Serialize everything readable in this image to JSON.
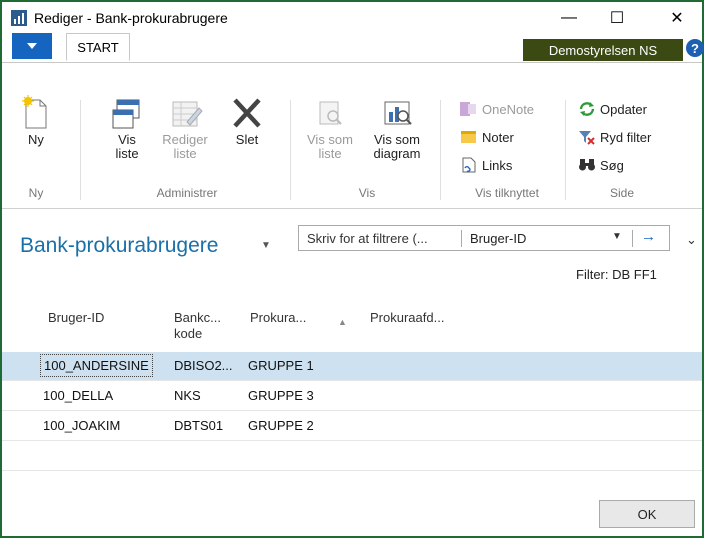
{
  "window": {
    "title": "Rediger - Bank-prokurabrugere",
    "minimize": "—",
    "maximize": "☐",
    "close": "✕"
  },
  "ribbon": {
    "tab_start": "START",
    "company": "Demostyrelsen NS",
    "help": "?",
    "groups": {
      "ny": "Ny",
      "administrer": "Administrer",
      "vis": "Vis",
      "vis_tilknyttet": "Vis tilknyttet",
      "side": "Side"
    },
    "buttons": {
      "ny": "Ny",
      "vis_liste_1": "Vis",
      "vis_liste_2": "liste",
      "rediger_liste_1": "Rediger",
      "rediger_liste_2": "liste",
      "slet": "Slet",
      "vis_som_liste_1": "Vis som",
      "vis_som_liste_2": "liste",
      "vis_som_diagram_1": "Vis som",
      "vis_som_diagram_2": "diagram",
      "onenote": "OneNote",
      "noter": "Noter",
      "links": "Links",
      "opdater": "Opdater",
      "ryd_filter": "Ryd filter",
      "sog": "Søg"
    }
  },
  "page": {
    "title": "Bank-prokurabrugere",
    "filter_placeholder": "Skriv for at filtrere (...",
    "filter_field": "Bruger-ID",
    "filter_info": "Filter: DB FF1"
  },
  "grid": {
    "headers": {
      "bruger_id": "Bruger-ID",
      "bankcode_1": "Bankc...",
      "bankcode_2": "kode",
      "prokura": "Prokura...",
      "prokuraafd": "Prokuraafd..."
    },
    "rows": [
      {
        "bruger_id": "100_ANDERSINE",
        "bankcode": "DBISO2...",
        "prokura": "GRUPPE 1",
        "prokuraafd": ""
      },
      {
        "bruger_id": "100_DELLA",
        "bankcode": "NKS",
        "prokura": "GRUPPE 3",
        "prokuraafd": ""
      },
      {
        "bruger_id": "100_JOAKIM",
        "bankcode": "DBTS01",
        "prokura": "GRUPPE 2",
        "prokuraafd": ""
      }
    ]
  },
  "footer": {
    "ok": "OK"
  },
  "colors": {
    "accent_blue": "#1565c0",
    "company_bg": "#3a4a12",
    "window_border": "#1e6b33",
    "selected_row": "#cde1f0",
    "title_blue": "#1b6fa8"
  }
}
